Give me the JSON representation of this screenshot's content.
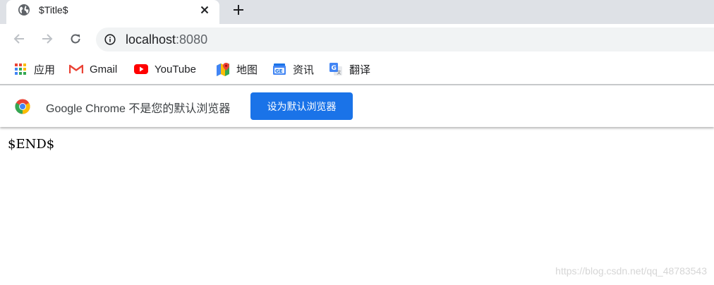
{
  "tab": {
    "title": "$Title$",
    "favicon": "globe-icon",
    "close_icon": "close-icon",
    "new_tab_icon": "plus-icon"
  },
  "toolbar": {
    "back_icon": "arrow-left-icon",
    "forward_icon": "arrow-right-icon",
    "reload_icon": "reload-icon",
    "site_info_icon": "info-icon",
    "url_host": "localhost",
    "url_port": ":8080"
  },
  "bookmarks": [
    {
      "label": "应用",
      "icon": "apps-grid-icon"
    },
    {
      "label": "Gmail",
      "icon": "gmail-icon"
    },
    {
      "label": "YouTube",
      "icon": "youtube-icon"
    },
    {
      "label": "地图",
      "icon": "maps-icon"
    },
    {
      "label": "资讯",
      "icon": "news-icon"
    },
    {
      "label": "翻译",
      "icon": "translate-icon"
    }
  ],
  "infobar": {
    "icon": "chrome-logo-icon",
    "message": "Google Chrome 不是您的默认浏览器",
    "button_label": "设为默认浏览器"
  },
  "page": {
    "content": "$END$"
  },
  "watermark": "https://blog.csdn.net/qq_48783543",
  "colors": {
    "tabstrip": "#dee1e6",
    "accent_button": "#1a73e8",
    "omnibox": "#f1f3f4"
  }
}
